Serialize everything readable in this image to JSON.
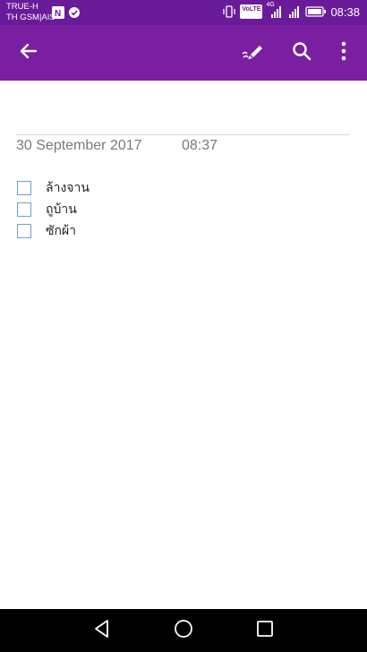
{
  "status_bar": {
    "carrier_line1": "TRUE-H",
    "carrier_line2": "TH GSM|AIS",
    "volte_label": "VoLTE",
    "network_label": "4G",
    "time": "08:38",
    "icons": [
      "onenote-notification-icon",
      "check-circle-icon",
      "vibrate-icon",
      "volte-icon",
      "signal-icon",
      "signal-2-icon",
      "battery-icon"
    ]
  },
  "app_bar": {
    "icons": [
      "back-arrow-icon",
      "pen-edit-icon",
      "search-icon",
      "more-vert-icon"
    ],
    "color": "#7b1fa2"
  },
  "note": {
    "date": "30 September 2017",
    "time": "08:37",
    "todo_items": [
      {
        "label": "ล้างจาน",
        "checked": false
      },
      {
        "label": "ถูบ้าน",
        "checked": false
      },
      {
        "label": "ซักผ้า",
        "checked": false
      }
    ]
  },
  "nav_bar": {
    "icons": [
      "back-triangle-icon",
      "home-circle-icon",
      "recents-square-icon"
    ]
  },
  "colors": {
    "status_bar": "#6a1b9a",
    "app_bar": "#7b1fa2",
    "checkbox_border": "#6e9ed6",
    "date_text": "#7a7a7a"
  }
}
